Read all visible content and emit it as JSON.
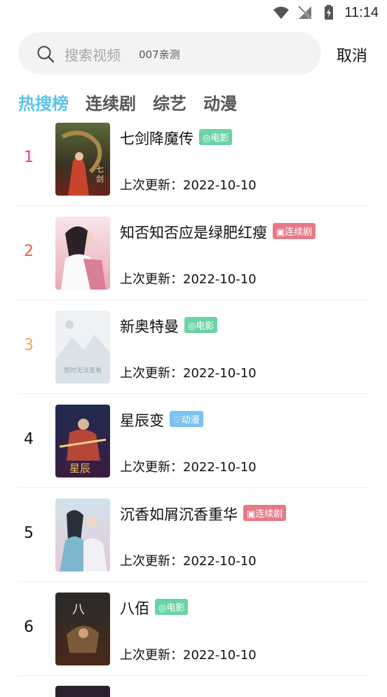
{
  "status_bar": {
    "time": "11:14"
  },
  "search": {
    "placeholder": "搜索视频",
    "hint": "007亲测",
    "cancel_label": "取消"
  },
  "tabs": [
    {
      "label": "热搜榜",
      "active": true
    },
    {
      "label": "连续剧",
      "active": false
    },
    {
      "label": "综艺",
      "active": false
    },
    {
      "label": "动漫",
      "active": false
    }
  ],
  "colors": {
    "active_tab": "#5bc4ea",
    "rank_1": "#e83e8c",
    "rank_2": "#f4563f",
    "rank_3": "#f7a54a",
    "tag_movie": "#6bd4a4",
    "tag_series": "#e57a87",
    "tag_anime": "#7cc2ee"
  },
  "items": [
    {
      "rank": "1",
      "title": "七剑降魔传",
      "tag": "电影",
      "tag_icon": "film-icon",
      "update": "上次更新：2022-10-10"
    },
    {
      "rank": "2",
      "title": "知否知否应是绿肥红瘦",
      "tag": "连续剧",
      "tag_icon": "tv-icon",
      "update": "上次更新：2022-10-10"
    },
    {
      "rank": "3",
      "title": "新奥特曼",
      "tag": "电影",
      "tag_icon": "film-icon",
      "update": "上次更新：2022-10-10",
      "poster_placeholder": "暂时无法查看"
    },
    {
      "rank": "4",
      "title": "星辰变",
      "tag": "动漫",
      "tag_icon": "heart-icon",
      "update": "上次更新：2022-10-10"
    },
    {
      "rank": "5",
      "title": "沉香如屑沉香重华",
      "tag": "连续剧",
      "tag_icon": "tv-icon",
      "update": "上次更新：2022-10-10"
    },
    {
      "rank": "6",
      "title": "八佰",
      "tag": "电影",
      "tag_icon": "film-icon",
      "update": "上次更新：2022-10-10"
    }
  ]
}
